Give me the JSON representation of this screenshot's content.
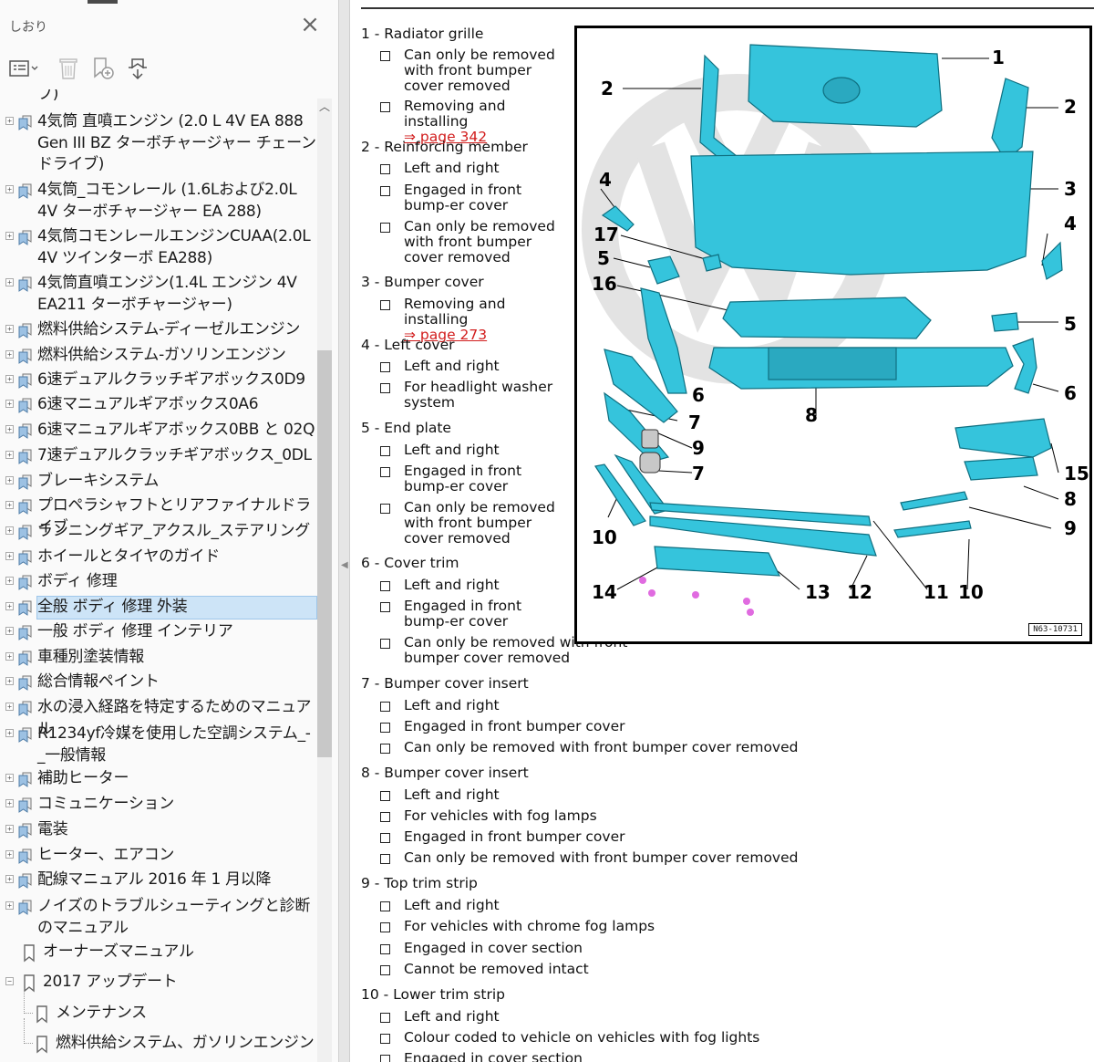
{
  "panel": {
    "title": "しおり",
    "close_icon": "close-icon",
    "toolbar": {
      "options_icon": "options-menu-icon",
      "delete_icon": "trash-icon",
      "add_icon": "add-bookmark-icon",
      "expand_icon": "expand-bookmark-icon"
    },
    "bookmarks": [
      {
        "label": "ブ)",
        "expandable": false,
        "icon": "bookmark-stack",
        "partial": true
      },
      {
        "label": "4気筒 直噴エンジン (2.0 L 4V EA 888 Gen III BZ ターボチャージャー チェーンドライブ)",
        "expandable": true,
        "icon": "bookmark-stack"
      },
      {
        "label": "4気筒_コモンレール (1.6Lおよび2.0L 4V ターボチャージャー EA 288)",
        "expandable": true,
        "icon": "bookmark-stack"
      },
      {
        "label": "4気筒コモンレールエンジンCUAA(2.0L 4V ツインターボ EA288)",
        "expandable": true,
        "icon": "bookmark-stack"
      },
      {
        "label": "4気筒直噴エンジン(1.4L エンジン 4V EA211 ターボチャージャー)",
        "expandable": true,
        "icon": "bookmark-stack"
      },
      {
        "label": "燃料供給システム-ディーゼルエンジン",
        "expandable": true,
        "icon": "bookmark-stack"
      },
      {
        "label": "燃料供給システム-ガソリンエンジン",
        "expandable": true,
        "icon": "bookmark-stack"
      },
      {
        "label": "6速デュアルクラッチギアボックス0D9",
        "expandable": true,
        "icon": "bookmark-stack"
      },
      {
        "label": "6速マニュアルギアボックス0A6",
        "expandable": true,
        "icon": "bookmark-stack"
      },
      {
        "label": "6速マニュアルギアボックス0BB と 02Q",
        "expandable": true,
        "icon": "bookmark-stack"
      },
      {
        "label": "7速デュアルクラッチギアボックス_0DL",
        "expandable": true,
        "icon": "bookmark-stack"
      },
      {
        "label": "ブレーキシステム",
        "expandable": true,
        "icon": "bookmark-stack"
      },
      {
        "label": "プロペラシャフトとリアファイナルドライブ",
        "expandable": true,
        "icon": "bookmark-stack"
      },
      {
        "label": "ランニングギア_アクスル_ステアリング",
        "expandable": true,
        "icon": "bookmark-stack"
      },
      {
        "label": "ホイールとタイヤのガイド",
        "expandable": true,
        "icon": "bookmark-stack"
      },
      {
        "label": "ボディ 修理",
        "expandable": true,
        "icon": "bookmark-stack"
      },
      {
        "label": "全般 ボディ 修理 外装",
        "expandable": true,
        "icon": "bookmark-stack",
        "selected": true
      },
      {
        "label": "一般 ボディ 修理 インテリア",
        "expandable": true,
        "icon": "bookmark-stack"
      },
      {
        "label": "車種別塗装情報",
        "expandable": true,
        "icon": "bookmark-stack"
      },
      {
        "label": "総合情報ペイント",
        "expandable": true,
        "icon": "bookmark-stack"
      },
      {
        "label": "水の浸入経路を特定するためのマニュアル",
        "expandable": true,
        "icon": "bookmark-stack"
      },
      {
        "label": "R1234yf冷媒を使用した空調システム_-_一般情報",
        "expandable": true,
        "icon": "bookmark-stack"
      },
      {
        "label": "補助ヒーター",
        "expandable": true,
        "icon": "bookmark-stack"
      },
      {
        "label": "コミュニケーション",
        "expandable": true,
        "icon": "bookmark-stack"
      },
      {
        "label": "電装",
        "expandable": true,
        "icon": "bookmark-stack"
      },
      {
        "label": "ヒーター、エアコン",
        "expandable": true,
        "icon": "bookmark-stack"
      },
      {
        "label": "配線マニュアル 2016 年 1 月以降",
        "expandable": true,
        "icon": "bookmark-stack"
      },
      {
        "label": "ノイズのトラブルシューティングと診断のマニュアル",
        "expandable": true,
        "icon": "bookmark-stack"
      },
      {
        "label": "オーナーズマニュアル",
        "expandable": false,
        "icon": "bookmark"
      },
      {
        "label": "2017 アップデート",
        "expandable": true,
        "expanded": true,
        "icon": "bookmark"
      },
      {
        "label": "メンテナンス",
        "expandable": false,
        "icon": "bookmark",
        "child": true
      },
      {
        "label": "燃料供給システム、ガソリンエンジン",
        "expandable": false,
        "icon": "bookmark",
        "child": true
      }
    ]
  },
  "document": {
    "entries": [
      {
        "title": "1 - Radiator grille",
        "items": [
          {
            "text": "Can only be removed with front bumper cover removed"
          },
          {
            "text": "Removing and installing",
            "link": "⇒ page 342"
          }
        ]
      },
      {
        "title": "2 - Reinforcing member",
        "items": [
          {
            "text": "Left and right"
          },
          {
            "text": "Engaged in front bump-er cover"
          },
          {
            "text": "Can only be removed with front bumper cover removed"
          }
        ]
      },
      {
        "title": "3 - Bumper cover",
        "items": [
          {
            "text": "Removing and installing",
            "link": "⇒ page 273"
          }
        ]
      },
      {
        "title": "4 - Left cover",
        "items": [
          {
            "text": "Left and right"
          },
          {
            "text": "For headlight washer system"
          }
        ]
      },
      {
        "title": "5 - End plate",
        "items": [
          {
            "text": "Left and right"
          },
          {
            "text": "Engaged in front bump-er cover"
          },
          {
            "text": "Can only be removed with front bumper cover removed"
          }
        ]
      },
      {
        "title": "6 - Cover trim",
        "items": [
          {
            "text": "Left and right"
          },
          {
            "text": "Engaged in front bump-er cover"
          },
          {
            "text": "Can only be removed with front bumper cover removed"
          }
        ]
      },
      {
        "title": "7 - Bumper cover insert",
        "items": [
          {
            "text": "Left and right"
          },
          {
            "text": "Engaged in front bumper cover"
          },
          {
            "text": "Can only be removed with front bumper cover removed"
          }
        ]
      },
      {
        "title": "8 - Bumper cover insert",
        "items": [
          {
            "text": "Left and right"
          },
          {
            "text": "For vehicles with fog lamps"
          },
          {
            "text": "Engaged in front bumper cover"
          },
          {
            "text": "Can only be removed with front bumper cover removed"
          }
        ]
      },
      {
        "title": "9 - Top trim strip",
        "items": [
          {
            "text": "Left and right"
          },
          {
            "text": "For vehicles with chrome fog lamps"
          },
          {
            "text": "Engaged in cover section"
          },
          {
            "text": "Cannot be removed intact"
          }
        ]
      },
      {
        "title": "10 - Lower trim strip",
        "items": [
          {
            "text": "Left and right"
          },
          {
            "text": "Colour coded to vehicle on vehicles with fog lights"
          },
          {
            "text": "Engaged in cover section"
          }
        ]
      }
    ],
    "figure": {
      "id": "N63-10731",
      "callouts": [
        "1",
        "2",
        "2",
        "3",
        "4",
        "4",
        "17",
        "5",
        "5",
        "16",
        "6",
        "6",
        "7",
        "8",
        "9",
        "15",
        "7",
        "8",
        "9",
        "10",
        "14",
        "13",
        "12",
        "11",
        "10"
      ],
      "part_color": "#35c4dc",
      "outline_color": "#0f6f80"
    }
  }
}
